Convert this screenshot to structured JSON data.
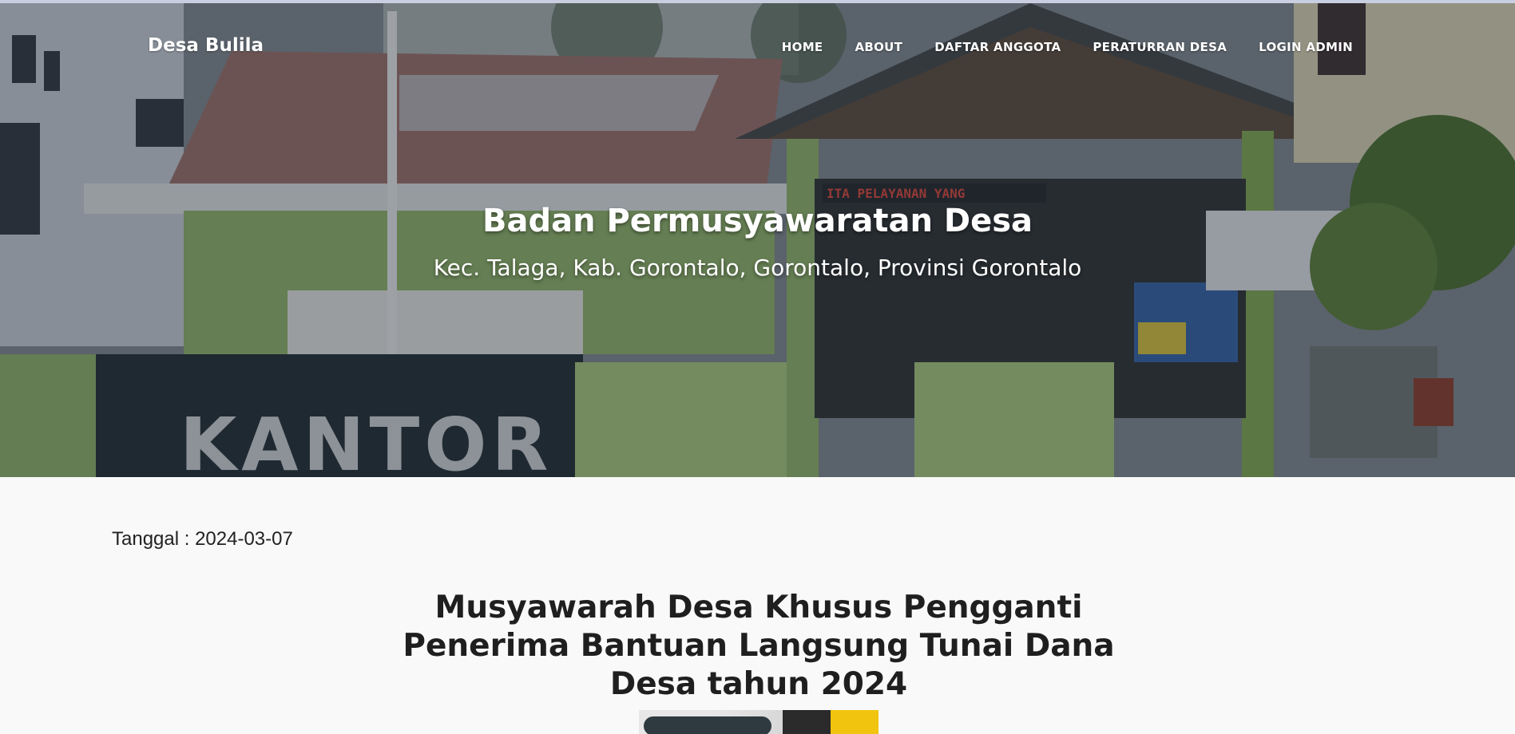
{
  "navbar": {
    "brand": "Desa Bulila",
    "links": [
      {
        "label": "HOME"
      },
      {
        "label": "ABOUT"
      },
      {
        "label": "DAFTAR ANGGOTA"
      },
      {
        "label": "PERATURRAN DESA"
      },
      {
        "label": "LOGIN ADMIN"
      }
    ]
  },
  "hero": {
    "title": "Badan Permusyawaratan Desa",
    "subtitle": "Kec. Talaga, Kab. Gorontalo, Gorontalo, Provinsi Gorontalo",
    "background_signs": [
      "KANTOR",
      "ITA PELAYANAN YANG"
    ]
  },
  "post": {
    "date_line": "Tanggal : 2024-03-07",
    "title": "Musyawarah Desa Khusus Pengganti Penerima Bantuan Langsung Tunai Dana Desa tahun 2024"
  },
  "colors": {
    "hero_overlay": "#232830",
    "text_light": "#ffffff",
    "text_dark": "#1f1f1f",
    "page_bg": "#f9f9f9",
    "building_green": "#7fa84f"
  }
}
